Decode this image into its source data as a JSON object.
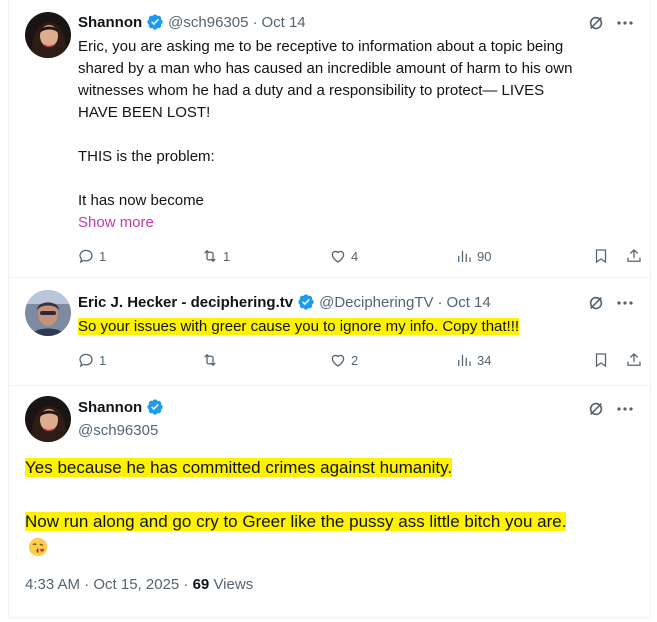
{
  "tweet1": {
    "name": "Shannon",
    "handle": "@sch96305",
    "separator": "·",
    "time": "Oct 14",
    "lines": [
      "Eric, you are asking me to be receptive to information about a topic being",
      "shared by a man who has caused an incredible amount of harm to his own",
      "witnesses whom he had a duty and a responsibility to protect— LIVES",
      "HAVE BEEN LOST!",
      "THIS is the problem:",
      "It has now become"
    ],
    "show_more": "Show more",
    "replies": "1",
    "reposts": "1",
    "likes": "4",
    "views": "90"
  },
  "tweet2": {
    "name": "Eric J. Hecker - deciphering.tv",
    "handle": "@DecipheringTV",
    "separator": "·",
    "time": "Oct 14",
    "text": "So your issues with greer cause you to ignore my info. Copy that!!!",
    "replies": "1",
    "reposts": "",
    "likes": "2",
    "views": "34"
  },
  "tweet3": {
    "name": "Shannon",
    "handle": "@sch96305",
    "line1": "Yes because he has committed crimes against humanity.",
    "line2": "Now run along and go cry to Greer like the pussy ass little bitch you are.",
    "timestamp": "4:33 AM · Oct 15, 2025 · ",
    "views_count": "69",
    "views_label": " Views"
  },
  "colors": {
    "verified": "#1d9bf0",
    "highlight": "#fff200",
    "secondary_text": "#536471",
    "show_more": "#c03ba7"
  },
  "icons": [
    "verified-badge-icon",
    "grok-icon",
    "more-icon",
    "reply-icon",
    "repost-icon",
    "like-icon",
    "views-icon",
    "bookmark-icon",
    "share-icon",
    "kiss-emoji-icon"
  ]
}
